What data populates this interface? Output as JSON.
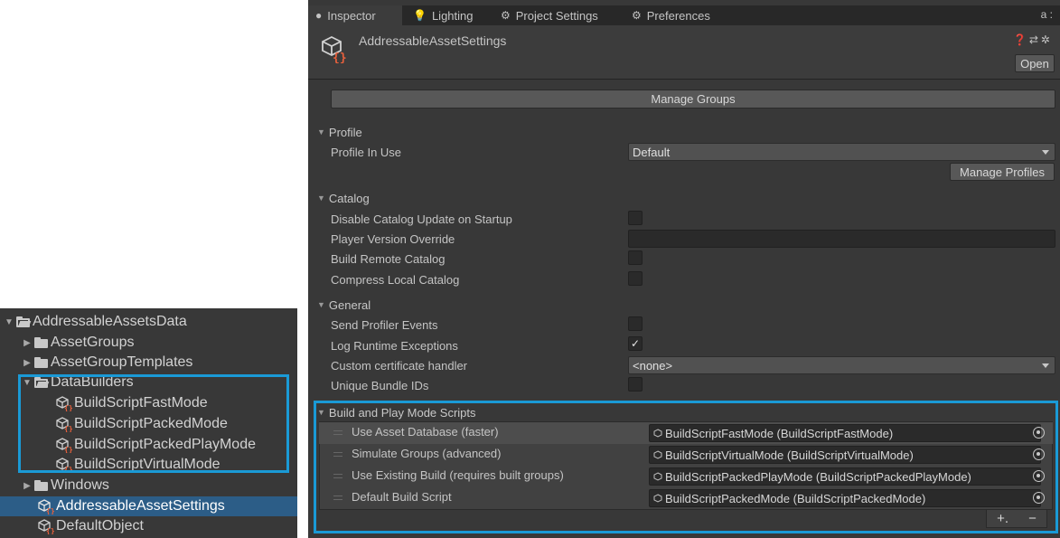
{
  "project": {
    "items": [
      {
        "label": "AddressableAssetsData",
        "kind": "folder-open",
        "expanded": true
      },
      {
        "label": "AssetGroups",
        "kind": "folder",
        "expanded": false
      },
      {
        "label": "AssetGroupTemplates",
        "kind": "folder",
        "expanded": false
      },
      {
        "label": "DataBuilders",
        "kind": "folder-open",
        "expanded": true
      },
      {
        "label": "BuildScriptFastMode",
        "kind": "asset"
      },
      {
        "label": "BuildScriptPackedMode",
        "kind": "asset"
      },
      {
        "label": "BuildScriptPackedPlayMode",
        "kind": "asset"
      },
      {
        "label": "BuildScriptVirtualMode",
        "kind": "asset"
      },
      {
        "label": "Windows",
        "kind": "folder",
        "expanded": false
      },
      {
        "label": "AddressableAssetSettings",
        "kind": "asset",
        "selected": true
      },
      {
        "label": "DefaultObject",
        "kind": "asset"
      }
    ]
  },
  "inspector": {
    "tabs": [
      {
        "label": "Inspector",
        "icon": "info-icon",
        "active": true
      },
      {
        "label": "Lighting",
        "icon": "bulb-icon"
      },
      {
        "label": "Project Settings",
        "icon": "gear-icon"
      },
      {
        "label": "Preferences",
        "icon": "gear-icon"
      }
    ],
    "tab_corner": "a :",
    "title": "AddressableAssetSettings",
    "header_tools": "❓⇄✲",
    "open_label": "Open",
    "manage_groups_label": "Manage Groups",
    "profile": {
      "title": "Profile",
      "profile_in_use_label": "Profile In Use",
      "profile_value": "Default",
      "manage_profiles_label": "Manage Profiles"
    },
    "catalog": {
      "title": "Catalog",
      "disable_update_label": "Disable Catalog Update on Startup",
      "disable_update_checked": false,
      "player_version_label": "Player Version Override",
      "player_version_value": "",
      "build_remote_label": "Build Remote Catalog",
      "build_remote_checked": false,
      "compress_local_label": "Compress Local Catalog",
      "compress_local_checked": false
    },
    "general": {
      "title": "General",
      "send_profiler_label": "Send Profiler Events",
      "send_profiler_checked": false,
      "log_exceptions_label": "Log Runtime Exceptions",
      "log_exceptions_check": "✓",
      "cert_handler_label": "Custom certificate handler",
      "cert_handler_value": "<none>",
      "unique_ids_label": "Unique Bundle IDs",
      "unique_ids_checked": false
    },
    "build_scripts": {
      "title": "Build and Play Mode Scripts",
      "rows": [
        {
          "label": "Use Asset Database (faster)",
          "value": "BuildScriptFastMode (BuildScriptFastMode)"
        },
        {
          "label": "Simulate Groups (advanced)",
          "value": "BuildScriptVirtualMode (BuildScriptVirtualMode)"
        },
        {
          "label": "Use Existing Build (requires built groups)",
          "value": "BuildScriptPackedPlayMode (BuildScriptPackedPlayMode)"
        },
        {
          "label": "Default Build Script",
          "value": "BuildScriptPackedMode (BuildScriptPackedMode)"
        }
      ],
      "add_label": "+.",
      "remove_label": "−"
    }
  },
  "colors": {
    "highlight": "#1a9ad6",
    "selection": "#2c5d87",
    "panel_bg": "#383838"
  }
}
